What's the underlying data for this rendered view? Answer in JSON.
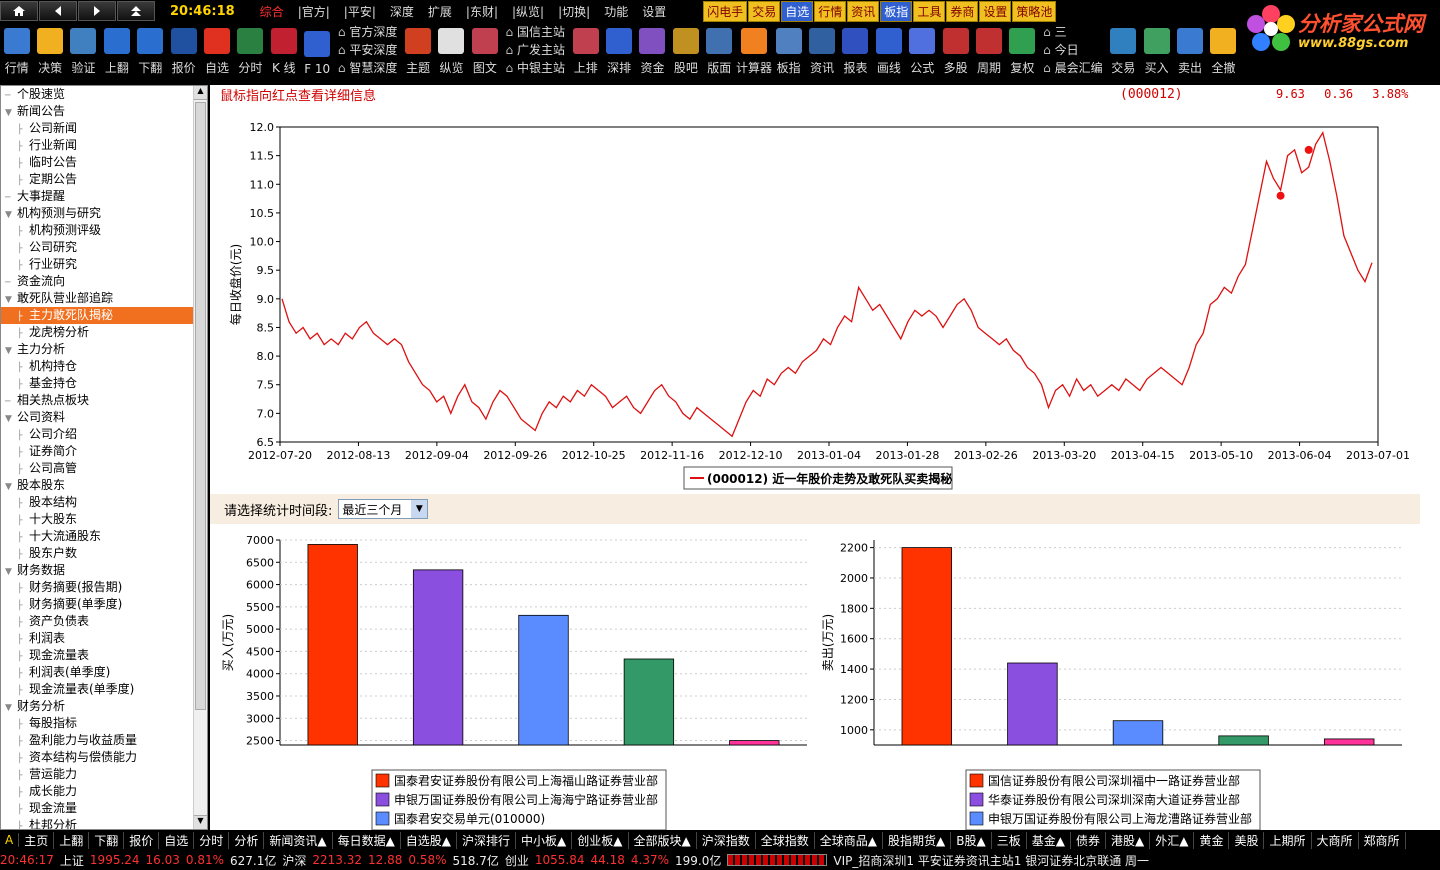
{
  "topbar": {
    "clock": "20:46:18",
    "menus": [
      "综合",
      "|官方|",
      "|平安|",
      "深度",
      "扩展",
      "|东财|",
      "|纵览|",
      "|切换|",
      "功能",
      "设置"
    ],
    "buttons": [
      "闪电手",
      "交易",
      "自选",
      "行情",
      "资讯",
      "板指",
      "工具",
      "券商",
      "设置",
      "策略池"
    ]
  },
  "logo": {
    "line1": "分析家公式网",
    "line2": "www.88gs.com"
  },
  "toolbar": {
    "left": [
      "行情",
      "决策",
      "验证",
      "上翻",
      "下翻",
      "报价",
      "自选",
      "分时",
      "K 线",
      "F 10"
    ],
    "grp1": [
      "官方深度",
      "平安深度",
      "智慧深度"
    ],
    "mid": [
      "主题",
      "纵览",
      "图文"
    ],
    "grp2": [
      "国信主站",
      "广发主站",
      "中银主站"
    ],
    "right": [
      "上排",
      "深排",
      "资金",
      "股吧",
      "版面",
      "计算器",
      "板指",
      "资讯",
      "报表",
      "画线",
      "公式",
      "多股",
      "周期",
      "复权"
    ],
    "grp3": [
      "三",
      "今日",
      "晨会汇编"
    ],
    "far": [
      "交易",
      "买入",
      "卖出",
      "全撤"
    ],
    "icon_f6": "F6",
    "icon_l2": "L2",
    "icon_aa": "Aa"
  },
  "sidebar": {
    "items": [
      {
        "t": "个股速览",
        "l": 0,
        "e": false
      },
      {
        "t": "新闻公告",
        "l": 0,
        "e": true
      },
      {
        "t": "公司新闻",
        "l": 1
      },
      {
        "t": "行业新闻",
        "l": 1
      },
      {
        "t": "临时公告",
        "l": 1
      },
      {
        "t": "定期公告",
        "l": 1
      },
      {
        "t": "大事提醒",
        "l": 0,
        "e": false
      },
      {
        "t": "机构预测与研究",
        "l": 0,
        "e": true
      },
      {
        "t": "机构预测评级",
        "l": 1
      },
      {
        "t": "公司研究",
        "l": 1
      },
      {
        "t": "行业研究",
        "l": 1
      },
      {
        "t": "资金流向",
        "l": 0,
        "e": false
      },
      {
        "t": "敢死队营业部追踪",
        "l": 0,
        "e": true
      },
      {
        "t": "主力敢死队揭秘",
        "l": 1,
        "sel": true
      },
      {
        "t": "龙虎榜分析",
        "l": 1
      },
      {
        "t": "主力分析",
        "l": 0,
        "e": true
      },
      {
        "t": "机构持仓",
        "l": 1
      },
      {
        "t": "基金持仓",
        "l": 1
      },
      {
        "t": "相关热点板块",
        "l": 0,
        "e": false
      },
      {
        "t": "公司资料",
        "l": 0,
        "e": true
      },
      {
        "t": "公司介绍",
        "l": 1
      },
      {
        "t": "证券简介",
        "l": 1
      },
      {
        "t": "公司高管",
        "l": 1
      },
      {
        "t": "股本股东",
        "l": 0,
        "e": true
      },
      {
        "t": "股本结构",
        "l": 1
      },
      {
        "t": "十大股东",
        "l": 1
      },
      {
        "t": "十大流通股东",
        "l": 1
      },
      {
        "t": "股东户数",
        "l": 1
      },
      {
        "t": "财务数据",
        "l": 0,
        "e": true
      },
      {
        "t": "财务摘要(报告期)",
        "l": 1
      },
      {
        "t": "财务摘要(单季度)",
        "l": 1
      },
      {
        "t": "资产负债表",
        "l": 1
      },
      {
        "t": "利润表",
        "l": 1
      },
      {
        "t": "现金流量表",
        "l": 1
      },
      {
        "t": "利润表(单季度)",
        "l": 1
      },
      {
        "t": "现金流量表(单季度)",
        "l": 1
      },
      {
        "t": "财务分析",
        "l": 0,
        "e": true
      },
      {
        "t": "每股指标",
        "l": 1
      },
      {
        "t": "盈利能力与收益质量",
        "l": 1
      },
      {
        "t": "资本结构与偿债能力",
        "l": 1
      },
      {
        "t": "营运能力",
        "l": 1
      },
      {
        "t": "成长能力",
        "l": 1
      },
      {
        "t": "现金流量",
        "l": 1
      },
      {
        "t": "杜邦分析",
        "l": 1
      }
    ]
  },
  "content": {
    "hint": "鼠标指向红点查看详细信息",
    "code": "(000012)",
    "price": "9.63",
    "change": "0.36",
    "pct": "3.88%",
    "period_label": "请选择统计时间段:",
    "period_value": "最近三个月"
  },
  "chart_data": [
    {
      "type": "line",
      "ylabel": "每日收盘价(元)",
      "ylim": [
        6.5,
        12.0
      ],
      "yticks": [
        "6.5",
        "7.0",
        "7.5",
        "8.0",
        "8.5",
        "9.0",
        "9.5",
        "10.0",
        "10.5",
        "11.0",
        "11.5",
        "12.0"
      ],
      "xticks": [
        "2012-07-20",
        "2012-08-13",
        "2012-09-04",
        "2012-09-26",
        "2012-10-25",
        "2012-11-16",
        "2012-12-10",
        "2013-01-04",
        "2013-01-28",
        "2013-02-26",
        "2013-03-20",
        "2013-04-15",
        "2013-05-10",
        "2013-06-04",
        "2013-07-01"
      ],
      "legend": "(000012) 近一年股价走势及敢死队买卖揭秘",
      "values": [
        9.0,
        8.6,
        8.4,
        8.5,
        8.3,
        8.4,
        8.2,
        8.3,
        8.2,
        8.4,
        8.3,
        8.5,
        8.6,
        8.4,
        8.3,
        8.2,
        8.3,
        8.2,
        7.9,
        7.7,
        7.5,
        7.4,
        7.2,
        7.3,
        7.0,
        7.3,
        7.5,
        7.2,
        7.1,
        6.9,
        7.2,
        7.4,
        7.3,
        7.1,
        6.9,
        6.8,
        6.7,
        7.0,
        7.2,
        7.1,
        7.3,
        7.2,
        7.4,
        7.3,
        7.5,
        7.4,
        7.3,
        7.1,
        7.2,
        7.3,
        7.1,
        7.0,
        7.2,
        7.4,
        7.5,
        7.3,
        7.2,
        7.0,
        6.9,
        7.1,
        7.0,
        6.9,
        6.8,
        6.7,
        6.6,
        6.9,
        7.2,
        7.4,
        7.3,
        7.6,
        7.5,
        7.7,
        7.8,
        7.7,
        7.9,
        8.0,
        8.1,
        8.3,
        8.2,
        8.5,
        8.7,
        8.6,
        9.2,
        9.0,
        8.8,
        8.9,
        8.7,
        8.5,
        8.3,
        8.6,
        8.8,
        8.7,
        8.8,
        8.7,
        8.5,
        8.7,
        8.9,
        9.0,
        8.8,
        8.5,
        8.4,
        8.3,
        8.2,
        8.3,
        8.1,
        8.0,
        7.8,
        7.7,
        7.5,
        7.1,
        7.4,
        7.5,
        7.3,
        7.6,
        7.4,
        7.5,
        7.3,
        7.4,
        7.5,
        7.4,
        7.6,
        7.5,
        7.4,
        7.6,
        7.7,
        7.8,
        7.7,
        7.6,
        7.5,
        7.8,
        8.2,
        8.4,
        8.9,
        9.0,
        9.2,
        9.1,
        9.4,
        9.6,
        10.2,
        10.8,
        11.4,
        11.1,
        10.9,
        11.5,
        11.6,
        11.2,
        11.3,
        11.7,
        11.9,
        11.4,
        10.8,
        10.1,
        9.8,
        9.5,
        9.3,
        9.63
      ],
      "markers": [
        {
          "i": 142,
          "v": 10.8
        },
        {
          "i": 146,
          "v": 11.6
        }
      ]
    },
    {
      "type": "bar",
      "ylabel": "买入(万元)",
      "ylim": [
        2400,
        7000
      ],
      "yticks": [
        "2500",
        "3000",
        "3500",
        "4000",
        "4500",
        "5000",
        "5500",
        "6000",
        "6500",
        "7000"
      ],
      "values": [
        6900,
        6330,
        5310,
        4330,
        2500
      ],
      "colors": [
        "#ff3300",
        "#8a4fdf",
        "#5b8cff",
        "#339966",
        "#ff3399"
      ],
      "legend": [
        "国泰君安证券股份有限公司上海福山路证券营业部",
        "申银万国证券股份有限公司上海海宁路证券营业部",
        "国泰君安交易单元(010000)"
      ]
    },
    {
      "type": "bar",
      "ylabel": "卖出(万元)",
      "ylim": [
        900,
        2250
      ],
      "yticks": [
        "1000",
        "1200",
        "1400",
        "1600",
        "1800",
        "2000",
        "2200"
      ],
      "values": [
        2200,
        1440,
        1060,
        960,
        940
      ],
      "colors": [
        "#ff3300",
        "#8a4fdf",
        "#5b8cff",
        "#339966",
        "#ff3399"
      ],
      "legend": [
        "国信证券股份有限公司深圳福中一路证券营业部",
        "华泰证券股份有限公司深圳深南大道证券营业部",
        "申银万国证券股份有限公司上海龙漕路证券营业部"
      ]
    }
  ],
  "bottomtabs": [
    "主页",
    "上翻",
    "下翻",
    "报价",
    "自选",
    "分时",
    "分析",
    "新闻资讯▲",
    "每日数据▲",
    "自选股▲",
    "沪深排行",
    "中小板▲",
    "创业板▲",
    "全部版块▲",
    "沪深指数",
    "全球指数",
    "全球商品▲",
    "股指期货▲",
    "B股▲",
    "三板",
    "基金▲",
    "债券",
    "港股▲",
    "外汇▲",
    "黄金",
    "美股",
    "上期所",
    "大商所",
    "郑商所"
  ],
  "status": {
    "time": "20:46:17",
    "sh": "上证",
    "sh_val": "1995.24",
    "sh_chg": "16.03",
    "sh_pct": "0.81%",
    "sh_amt": "627.1亿",
    "hs": "沪深",
    "hs_val": "2213.32",
    "hs_chg": "12.88",
    "hs_pct": "0.58%",
    "hs_amt": "518.7亿",
    "cy": "创业",
    "cy_val": "1055.84",
    "cy_chg": "44.18",
    "cy_pct": "4.37%",
    "cy_amt": "199.0亿",
    "ticker": "VIP_招商深圳1  平安证券资讯主站1  银河证券北京联通   周一"
  }
}
